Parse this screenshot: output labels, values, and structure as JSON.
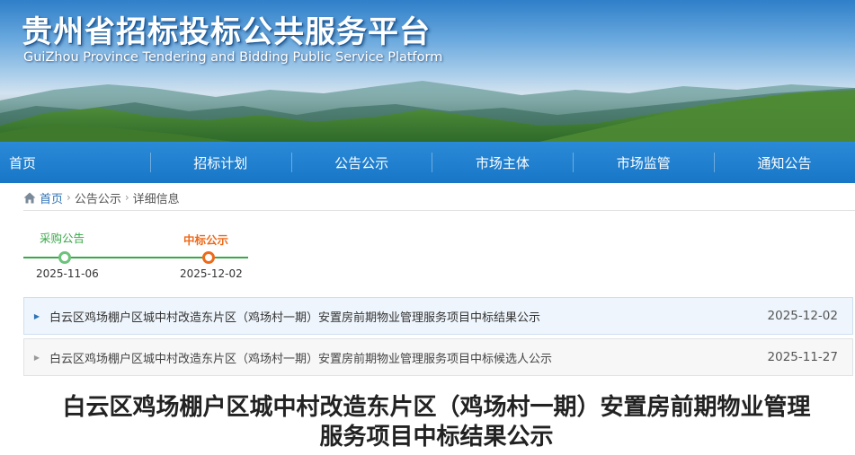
{
  "header": {
    "title": "贵州省招标投标公共服务平台",
    "subtitle": "GuiZhou Province Tendering and Bidding Public Service Platform"
  },
  "nav": {
    "items": [
      "首页",
      "招标计划",
      "公告公示",
      "市场主体",
      "市场监管",
      "通知公告"
    ]
  },
  "breadcrumb": {
    "home": "首页",
    "level2": "公告公示",
    "current": "详细信息",
    "separator": "›"
  },
  "timeline": {
    "steps": [
      {
        "label": "采购公告",
        "date": "2025-11-06",
        "state": "done"
      },
      {
        "label": "中标公示",
        "date": "2025-12-02",
        "state": "current"
      }
    ]
  },
  "related": {
    "items": [
      {
        "title": "白云区鸡场棚户区城中村改造东片区（鸡场村一期）安置房前期物业管理服务项目中标结果公示",
        "date": "2025-12-02"
      },
      {
        "title": "白云区鸡场棚户区城中村改造东片区（鸡场村一期）安置房前期物业管理服务项目中标候选人公示",
        "date": "2025-11-27"
      }
    ]
  },
  "article": {
    "title_line1": "白云区鸡场棚户区城中村改造东片区（鸡场村一期）安置房前期物业管理",
    "title_line2": "服务项目中标结果公示"
  },
  "colors": {
    "nav_blue": "#1876c6",
    "link_blue": "#2d73b6",
    "done_green": "#3aa84a",
    "current_orange": "#ee6a1b"
  }
}
